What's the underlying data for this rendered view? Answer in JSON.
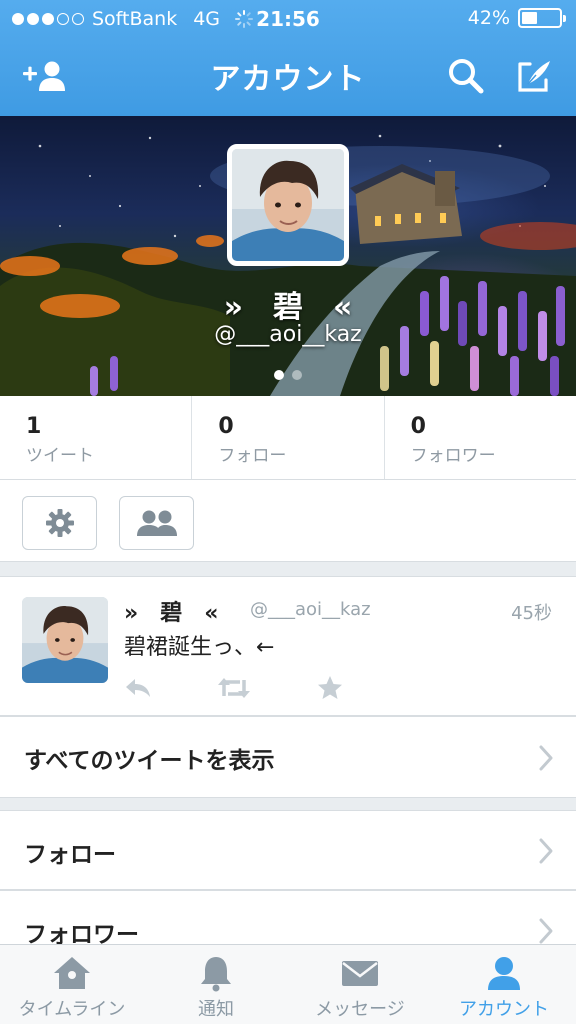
{
  "status_bar": {
    "carrier": "SoftBank",
    "network": "4G",
    "time": "21:56",
    "battery": "42%",
    "battery_level": 0.42
  },
  "nav": {
    "title": "アカウント",
    "add_user_icon": "add-user-icon",
    "search_icon": "search-icon",
    "compose_icon": "compose-icon"
  },
  "profile": {
    "name": "»　碧　«",
    "handle": "@___aoi__kaz",
    "page_count": 2,
    "current_page": 1
  },
  "stats": [
    {
      "count": "1",
      "label": "ツイート"
    },
    {
      "count": "0",
      "label": "フォロー"
    },
    {
      "count": "0",
      "label": "フォロワー"
    }
  ],
  "actions": {
    "settings_icon": "gear-icon",
    "people_icon": "people-icon"
  },
  "tweet": {
    "name": "»　碧　«",
    "handle": "@___aoi__kaz",
    "time": "45秒",
    "text": "碧裙誕生っ、←"
  },
  "rows": {
    "all_tweets": "すべてのツイートを表示",
    "following": "フォロー",
    "followers": "フォロワー"
  },
  "tabbar": {
    "tabs": [
      {
        "label": "タイムライン",
        "icon": "home-icon"
      },
      {
        "label": "通知",
        "icon": "bell-icon"
      },
      {
        "label": "メッセージ",
        "icon": "envelope-icon"
      },
      {
        "label": "アカウント",
        "icon": "user-icon"
      }
    ],
    "active_index": 3
  },
  "colors": {
    "accent": "#55acee",
    "tab_active": "#41a0e8",
    "tab_inactive": "#8c9aa5"
  }
}
